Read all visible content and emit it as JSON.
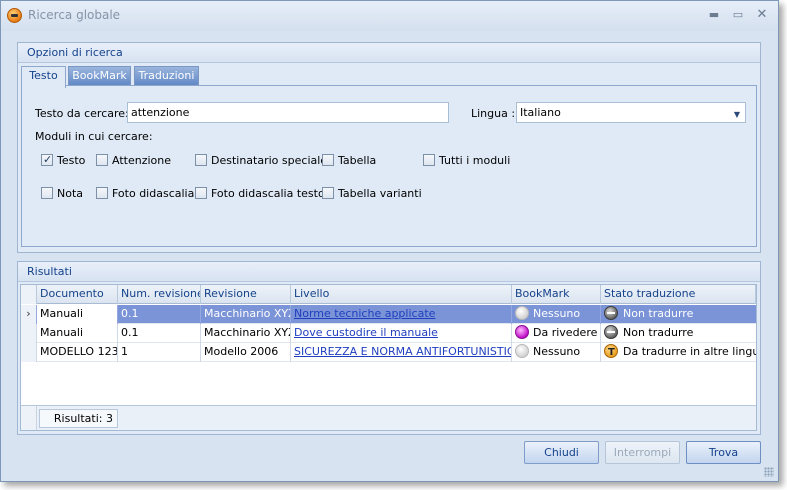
{
  "window": {
    "title": "Ricerca globale",
    "minimize": "▬",
    "maximize": "▭",
    "close": "✕"
  },
  "options": {
    "group_title": "Opzioni di ricerca",
    "tabs": [
      {
        "label": "Testo",
        "active": true
      },
      {
        "label": "BookMark",
        "active": false
      },
      {
        "label": "Traduzioni",
        "active": false
      }
    ],
    "search_label": "Testo da cercare:",
    "search_value": "attenzione",
    "language_label": "Lingua :",
    "language_value": "Italiano",
    "modules_label": "Moduli in cui cercare:",
    "modules": [
      {
        "label": "Testo",
        "checked": true
      },
      {
        "label": "Attenzione",
        "checked": false
      },
      {
        "label": "Destinatario speciale",
        "checked": false
      },
      {
        "label": "Tabella",
        "checked": false
      },
      {
        "label": "Tutti i moduli",
        "checked": false
      },
      {
        "label": "Nota",
        "checked": false
      },
      {
        "label": "Foto didascalia",
        "checked": false
      },
      {
        "label": "Foto didascalia testo",
        "checked": false
      },
      {
        "label": "Tabella varianti",
        "checked": false
      }
    ]
  },
  "results": {
    "group_title": "Risultati",
    "columns": [
      "Documento",
      "Num. revisione",
      "Revisione",
      "Livello",
      "BookMark",
      "Stato traduzione"
    ],
    "rows": [
      {
        "documento": "Manuali",
        "num_revisione": "0.1",
        "revisione": "Macchinario XYZ",
        "livello": "Norme tecniche applicate",
        "bookmark": "Nessuno",
        "bookmark_icon": "bookmark-none-icon",
        "stato": "Non tradurre",
        "stato_icon": "no-translate-icon",
        "selected": true
      },
      {
        "documento": "Manuali",
        "num_revisione": "0.1",
        "revisione": "Macchinario XYZ",
        "livello": "Dove custodire il manuale",
        "bookmark": "Da rivedere",
        "bookmark_icon": "bookmark-review-icon",
        "stato": "Non tradurre",
        "stato_icon": "no-translate-icon",
        "selected": false
      },
      {
        "documento": "MODELLO 123",
        "num_revisione": "1",
        "revisione": "Modello 2006",
        "livello": "SICUREZZA E NORMA ANTIFORTUNISTICA",
        "bookmark": "Nessuno",
        "bookmark_icon": "bookmark-none-icon",
        "stato": "Da tradurre in altre lingue",
        "stato_icon": "translate-other-languages-icon",
        "selected": false
      }
    ],
    "count_text": "Risultati: 3"
  },
  "buttons": {
    "close": "Chiudi",
    "stop": "Interrompi",
    "find": "Trova"
  },
  "colors": {
    "selected_row": "#7b94d8",
    "accent": "#15428b",
    "window_bg": "#d7e3f1"
  }
}
